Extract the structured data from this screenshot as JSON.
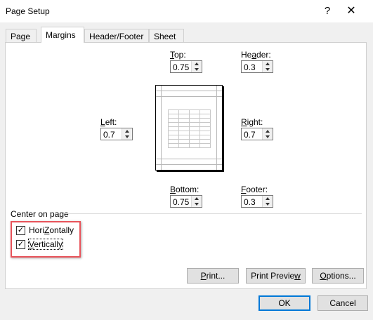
{
  "dialog": {
    "title": "Page Setup",
    "help_glyph": "?",
    "close_glyph": "✕"
  },
  "tabs": [
    {
      "label": "Page",
      "active": false
    },
    {
      "label": "Margins",
      "active": true
    },
    {
      "label": "Header/Footer",
      "active": false
    },
    {
      "label": "Sheet",
      "active": false
    }
  ],
  "margins": {
    "top": {
      "label_ul": "T",
      "label_rest": "op:",
      "value": "0.75"
    },
    "header": {
      "label_pre": "He",
      "label_ul": "a",
      "label_rest": "der:",
      "value": "0.3"
    },
    "left": {
      "label_ul": "L",
      "label_rest": "eft:",
      "value": "0.7"
    },
    "right": {
      "label_ul": "R",
      "label_rest": "ight:",
      "value": "0.7"
    },
    "bottom": {
      "label_ul": "B",
      "label_rest": "ottom:",
      "value": "0.75"
    },
    "footer": {
      "label_ul": "F",
      "label_rest": "ooter:",
      "value": "0.3"
    }
  },
  "center_on_page": {
    "label": "Center on page",
    "horizontally": {
      "label_ul": "Z",
      "label_pre": "Hori",
      "label_rest": "ontally",
      "checked": true,
      "check_glyph": "✓"
    },
    "vertically": {
      "label_ul": "V",
      "label_rest": "ertically",
      "checked": true,
      "check_glyph": "✓"
    }
  },
  "buttons": {
    "print": {
      "label_ul": "P",
      "label_rest": "rint..."
    },
    "print_preview": {
      "label_pre": "Print Previe",
      "label_ul": "w"
    },
    "options": {
      "label_ul": "O",
      "label_rest": "ptions..."
    },
    "ok": "OK",
    "cancel": "Cancel"
  },
  "colors": {
    "highlight": "#e8535a",
    "default_button_border": "#0078d7"
  }
}
